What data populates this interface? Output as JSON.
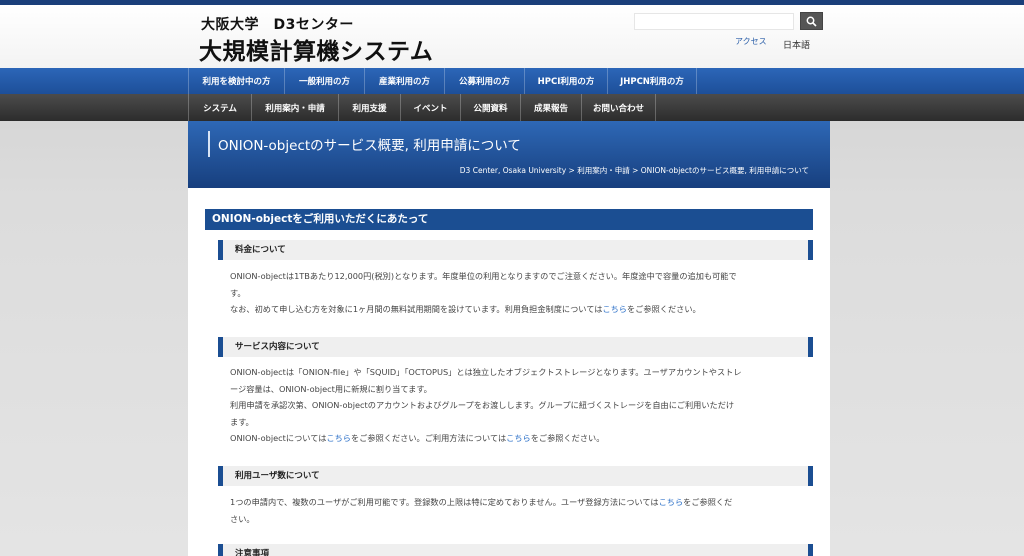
{
  "header": {
    "org": "大阪大学　D3センター",
    "title": "大規模計算機システム",
    "search_placeholder": "",
    "access_label": "アクセス",
    "lang_label": "日本語"
  },
  "nav_primary": [
    {
      "label": "利用を検討中の方"
    },
    {
      "label": "一般利用の方"
    },
    {
      "label": "産業利用の方"
    },
    {
      "label": "公募利用の方"
    },
    {
      "label": "HPCI利用の方"
    },
    {
      "label": "JHPCN利用の方"
    }
  ],
  "nav_secondary": [
    {
      "label": "システム"
    },
    {
      "label": "利用案内・申請"
    },
    {
      "label": "利用支援"
    },
    {
      "label": "イベント"
    },
    {
      "label": "公開資料"
    },
    {
      "label": "成果報告"
    },
    {
      "label": "お問い合わせ"
    }
  ],
  "banner": {
    "title": "ONION-objectのサービス概要, 利用申請について",
    "breadcrumb": "D3 Center, Osaka University > 利用案内・申請 > ONION-objectのサービス概要, 利用申請について"
  },
  "content": {
    "section_title": "ONION-objectをご利用いただくにあたって",
    "fee": {
      "heading": "料金について",
      "line1": "ONION-objectは1TBあたり12,000円(税別)となります。年度単位の利用となりますのでご注意ください。年度途中で容量の追加も可能で",
      "line2": "す。",
      "line3a": "なお、初めて申し込む方を対象に1ヶ月間の無料試用期間を設けています。利用負担金制度については",
      "line3_link": "こちら",
      "line3b": "をご参照ください。"
    },
    "service": {
      "heading": "サービス内容について",
      "line1": "ONION-objectは「ONION-file」や「SQUID」「OCTOPUS」とは独立したオブジェクトストレージとなります。ユーザアカウントやストレ",
      "line2": "ージ容量は、ONION-object用に新規に割り当てます。",
      "line3": "利用申請を承認次第、ONION-objectのアカウントおよびグループをお渡しします。グループに紐づくストレージを自由にご利用いただけ",
      "line4": "ます。",
      "line5a": "ONION-objectについては",
      "line5_link1": "こちら",
      "line5b": "をご参照ください。ご利用方法については",
      "line5_link2": "こちら",
      "line5c": "をご参照ください。"
    },
    "users": {
      "heading": "利用ユーザ数について",
      "line1a": "1つの申請内で、複数のユーザがご利用可能です。登録数の上限は特に定めておりません。ユーザ登録方法については",
      "line1_link": "こちら",
      "line1b": "をご参照くだ",
      "line2": "さい。"
    },
    "notes": {
      "heading": "注意事項"
    }
  }
}
